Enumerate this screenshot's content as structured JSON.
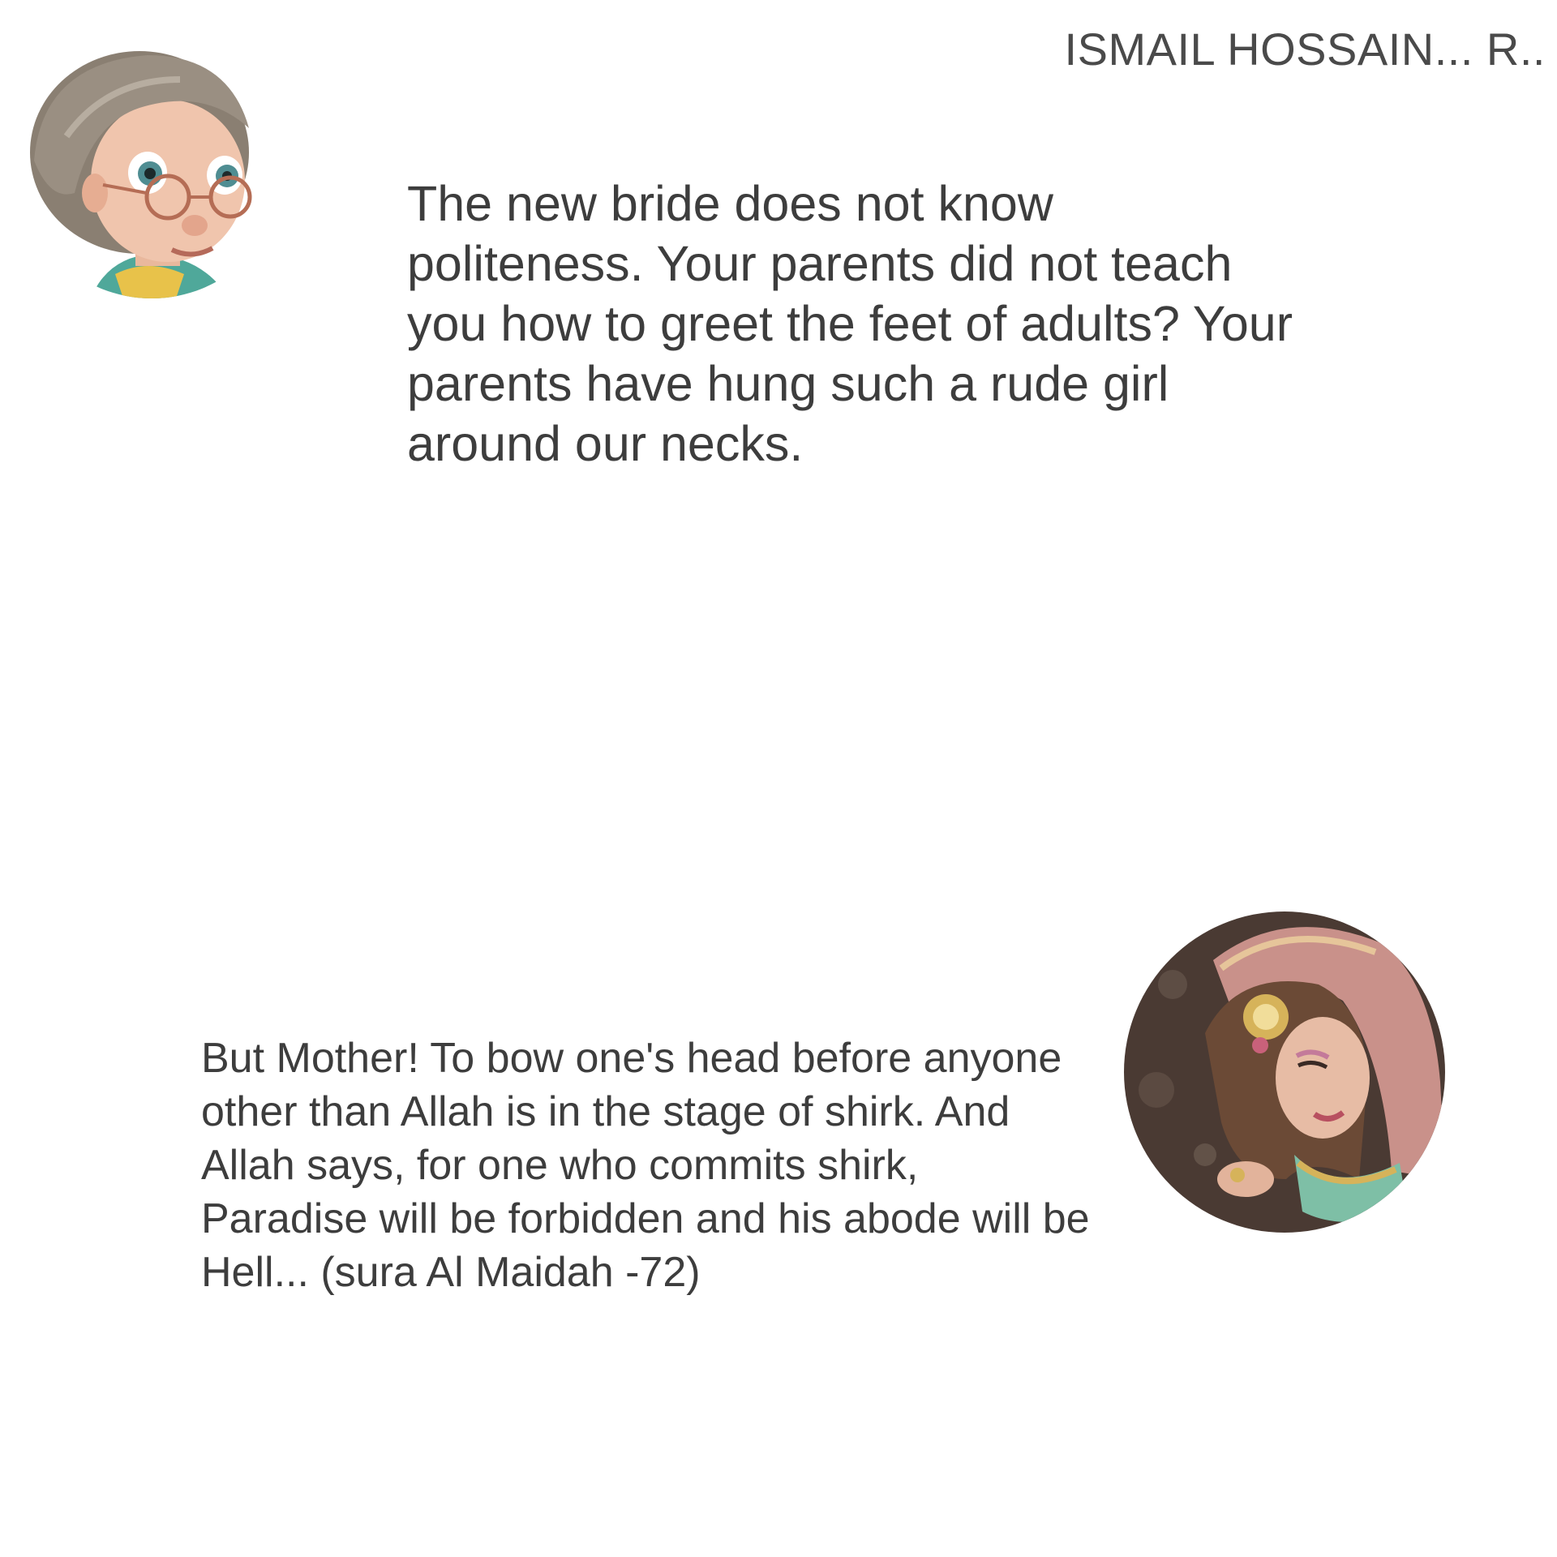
{
  "header": {
    "author": "ISMAIL HOSSAIN... R.."
  },
  "conversation": {
    "messages": [
      {
        "speaker_avatar": "elderly-woman-glasses-avatar",
        "text": "The new bride does not know politeness. Your parents did not teach you how to greet the feet of adults? Your parents have hung such a rude girl around our necks."
      },
      {
        "speaker_avatar": "bride-avatar",
        "text": "But Mother! To bow one's head before anyone other than Allah is in the stage of shirk. And Allah says, for one who commits shirk, Paradise will be forbidden and his abode will be Hell... (sura Al Maidah -72)"
      }
    ]
  },
  "colors": {
    "background": "#ffffff",
    "text": "#3d3d3d"
  }
}
